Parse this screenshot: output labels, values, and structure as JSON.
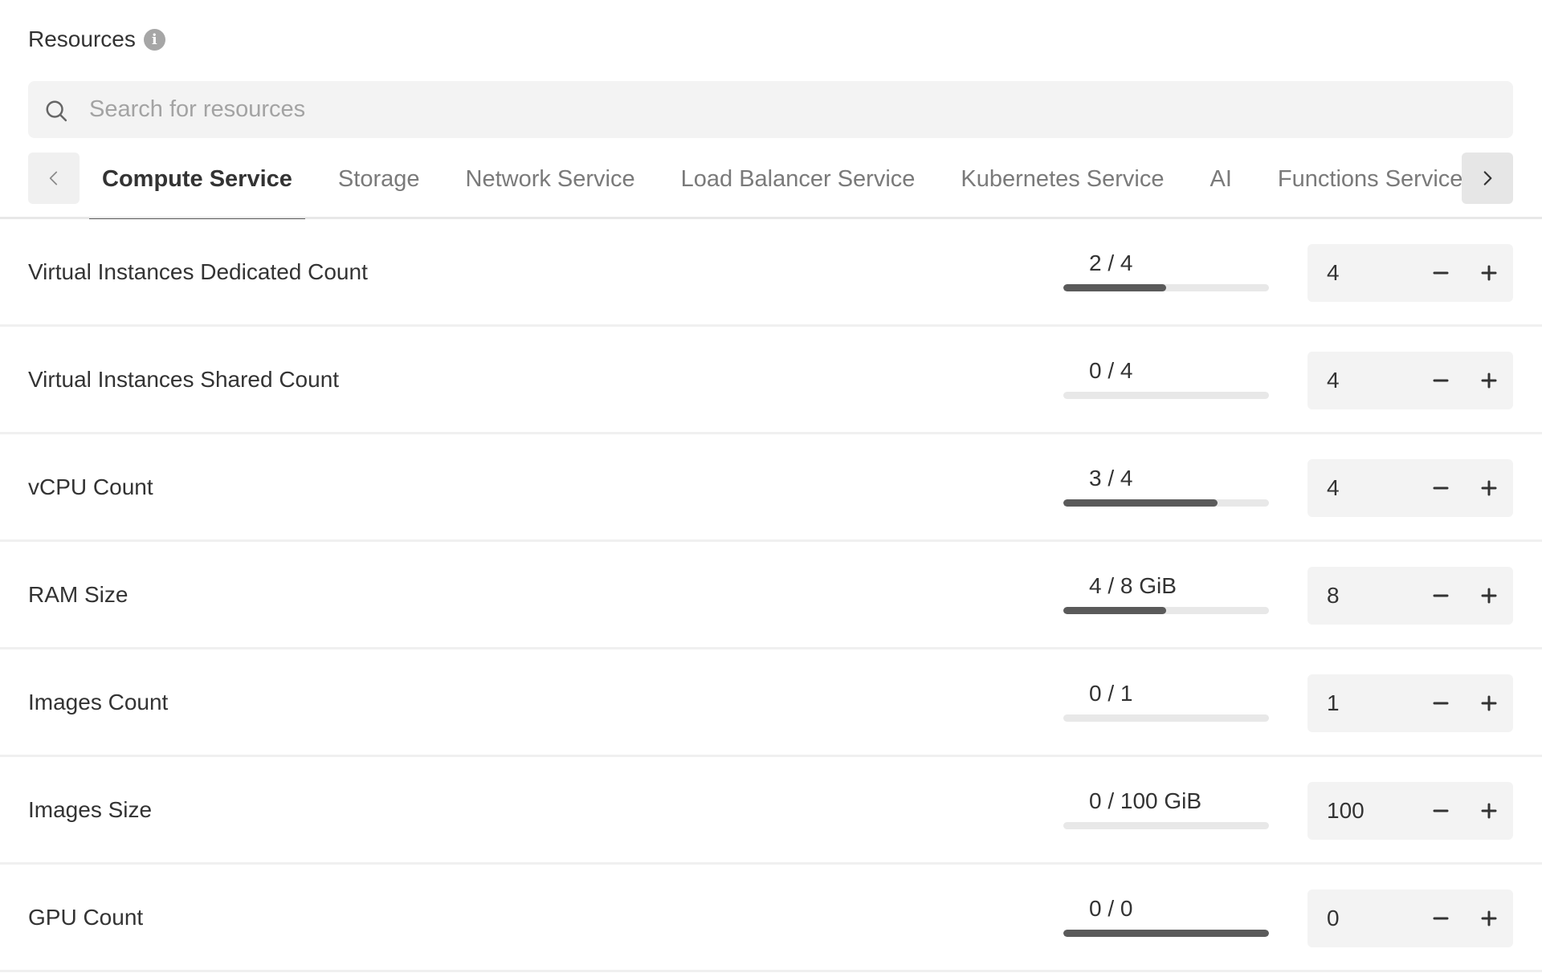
{
  "header": {
    "title": "Resources",
    "info_icon": "info-circle-icon"
  },
  "search": {
    "placeholder": "Search for resources",
    "value": "",
    "icon": "search-icon"
  },
  "tabs": {
    "prev_icon": "chevron-left-icon",
    "next_icon": "chevron-right-icon",
    "items": [
      {
        "label": "Compute Service",
        "active": true
      },
      {
        "label": "Storage",
        "active": false
      },
      {
        "label": "Network Service",
        "active": false
      },
      {
        "label": "Load Balancer Service",
        "active": false
      },
      {
        "label": "Kubernetes Service",
        "active": false
      },
      {
        "label": "AI",
        "active": false
      },
      {
        "label": "Functions Service",
        "active": false
      }
    ]
  },
  "colors": {
    "bar_fill": "#5a5a5a",
    "bar_track": "#e8e8e8",
    "field_bg": "#f3f3f3",
    "text": "#333333",
    "tab_inactive": "#7a7a7a"
  },
  "resources": [
    {
      "label": "Virtual Instances Dedicated Count",
      "usage": "2 / 4",
      "used": 2,
      "limit": 4,
      "fill": 0.5,
      "value": "4"
    },
    {
      "label": "Virtual Instances Shared Count",
      "usage": "0 / 4",
      "used": 0,
      "limit": 4,
      "fill": 0,
      "value": "4"
    },
    {
      "label": "vCPU Count",
      "usage": "3 / 4",
      "used": 3,
      "limit": 4,
      "fill": 0.75,
      "value": "4"
    },
    {
      "label": "RAM Size",
      "usage": "4 / 8 GiB",
      "used": 4,
      "limit": 8,
      "fill": 0.5,
      "value": "8"
    },
    {
      "label": "Images Count",
      "usage": "0 / 1",
      "used": 0,
      "limit": 1,
      "fill": 0,
      "value": "1"
    },
    {
      "label": "Images Size",
      "usage": "0 / 100 GiB",
      "used": 0,
      "limit": 100,
      "fill": 0,
      "value": "100"
    },
    {
      "label": "GPU Count",
      "usage": "0 / 0",
      "used": 0,
      "limit": 0,
      "fill": 1,
      "value": "0"
    }
  ]
}
